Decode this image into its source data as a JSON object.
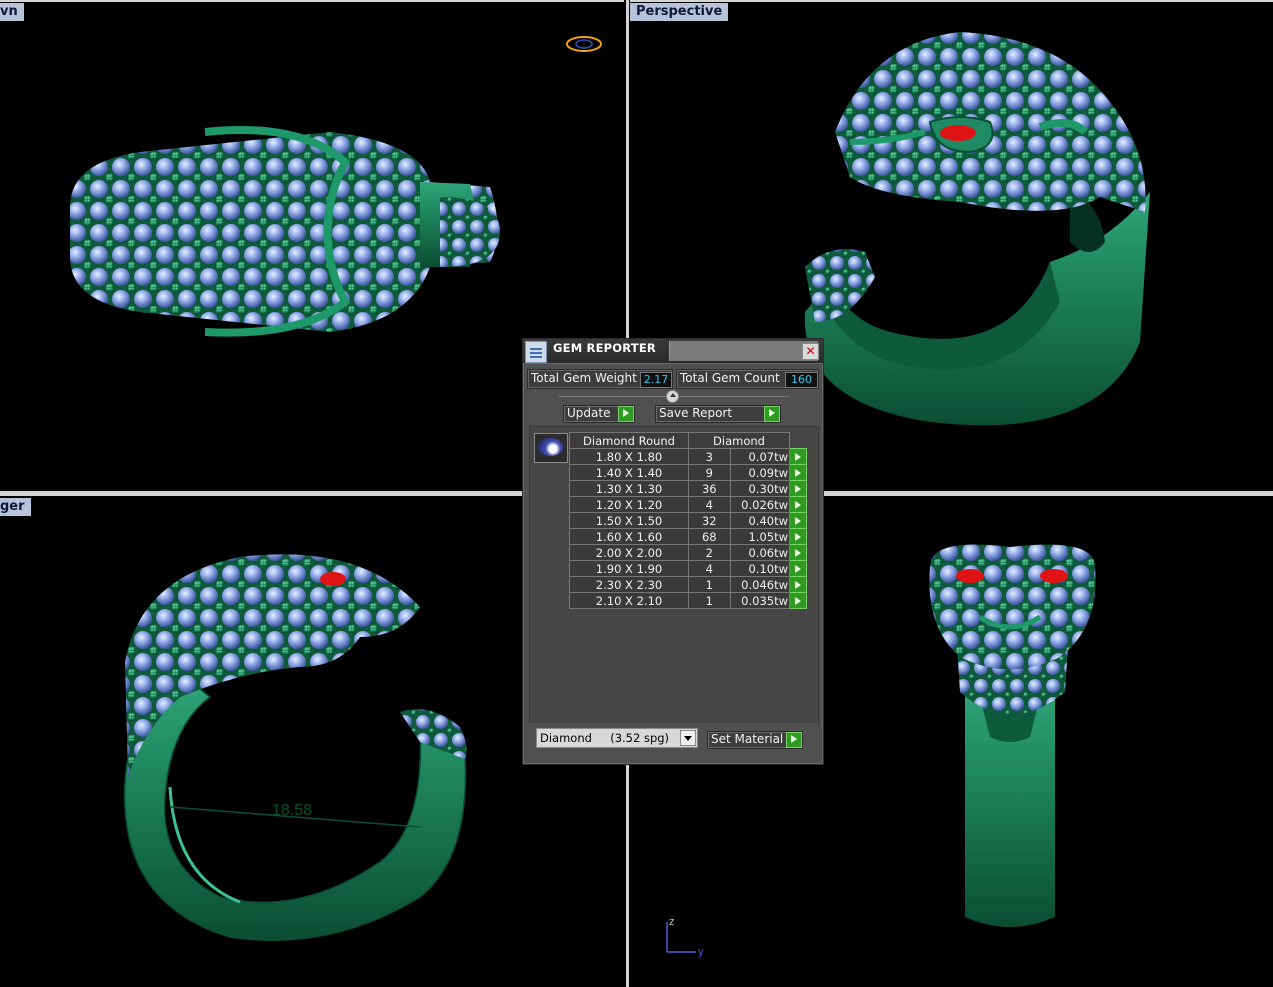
{
  "viewports": {
    "top_left": {
      "label": "vn"
    },
    "top_right": {
      "label": "Perspective"
    },
    "bottom_left": {
      "label": "ger"
    },
    "bottom_right": {
      "label": ""
    },
    "dimension": "18.58",
    "axis": {
      "z": "z",
      "y": "y"
    }
  },
  "dialog": {
    "title": "GEM REPORTER",
    "total_gem_weight_label": "Total Gem Weight",
    "total_gem_weight": "2.17",
    "total_gem_count_label": "Total Gem Count",
    "total_gem_count": "160",
    "update_label": "Update",
    "save_report_label": "Save Report",
    "columns": [
      "Diamond Round",
      "Diamond"
    ],
    "rows": [
      {
        "size": "1.80 X 1.80",
        "count": "3",
        "weight": "0.07tw"
      },
      {
        "size": "1.40 X 1.40",
        "count": "9",
        "weight": "0.09tw"
      },
      {
        "size": "1.30 X 1.30",
        "count": "36",
        "weight": "0.30tw"
      },
      {
        "size": "1.20 X 1.20",
        "count": "4",
        "weight": "0.026tw"
      },
      {
        "size": "1.50 X 1.50",
        "count": "32",
        "weight": "0.40tw"
      },
      {
        "size": "1.60 X 1.60",
        "count": "68",
        "weight": "1.05tw"
      },
      {
        "size": "2.00 X 2.00",
        "count": "2",
        "weight": "0.06tw"
      },
      {
        "size": "1.90 X 1.90",
        "count": "4",
        "weight": "0.10tw"
      },
      {
        "size": "2.30 X 2.30",
        "count": "1",
        "weight": "0.046tw"
      },
      {
        "size": "2.10 X 2.10",
        "count": "1",
        "weight": "0.035tw"
      }
    ],
    "material_select": "Diamond     (3.52 spg)",
    "set_material_label": "Set Material"
  },
  "colors": {
    "metal": "#1f8a63",
    "gem": "#8aa6e6",
    "eye": "#d01010",
    "label_bg": "#b6c3d8"
  }
}
